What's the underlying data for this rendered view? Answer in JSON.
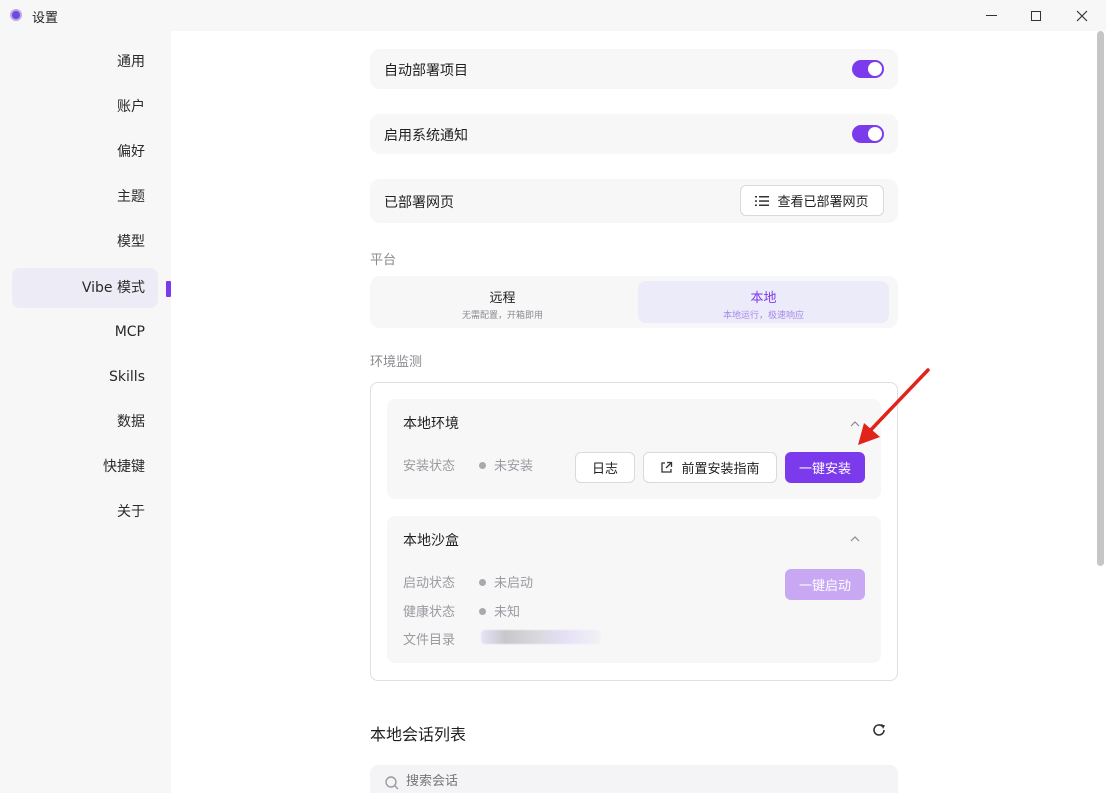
{
  "window": {
    "title": "设置"
  },
  "sidebar": {
    "items": [
      {
        "label": "通用"
      },
      {
        "label": "账户"
      },
      {
        "label": "偏好"
      },
      {
        "label": "主题"
      },
      {
        "label": "模型"
      },
      {
        "label": "Vibe 模式",
        "active": true
      },
      {
        "label": "MCP"
      },
      {
        "label": "Skills"
      },
      {
        "label": "数据"
      },
      {
        "label": "快捷键"
      },
      {
        "label": "关于"
      }
    ]
  },
  "settings": {
    "auto_deploy": {
      "label": "自动部署项目",
      "enabled": true
    },
    "system_notify": {
      "label": "启用系统通知",
      "enabled": true
    },
    "deployed_pages": {
      "label": "已部署网页",
      "button": "查看已部署网页"
    }
  },
  "platform": {
    "section_label": "平台",
    "options": [
      {
        "title": "远程",
        "subtitle": "无需配置，开箱即用",
        "active": false
      },
      {
        "title": "本地",
        "subtitle": "本地运行，极速响应",
        "active": true
      }
    ]
  },
  "env_monitor": {
    "section_label": "环境监测",
    "local_env": {
      "title": "本地环境",
      "status_key": "安装状态",
      "status_value": "未安装",
      "log_button": "日志",
      "guide_button": "前置安装指南",
      "install_button": "一键安装"
    },
    "local_sandbox": {
      "title": "本地沙盒",
      "start_key": "启动状态",
      "start_value": "未启动",
      "health_key": "健康状态",
      "health_value": "未知",
      "dir_key": "文件目录",
      "start_button": "一键启动"
    }
  },
  "sessions": {
    "title": "本地会话列表",
    "search_placeholder": "搜索会话"
  },
  "colors": {
    "accent": "#7c3aed",
    "accent_disabled": "#c9a8f3",
    "annotation_arrow": "#e0241b"
  }
}
